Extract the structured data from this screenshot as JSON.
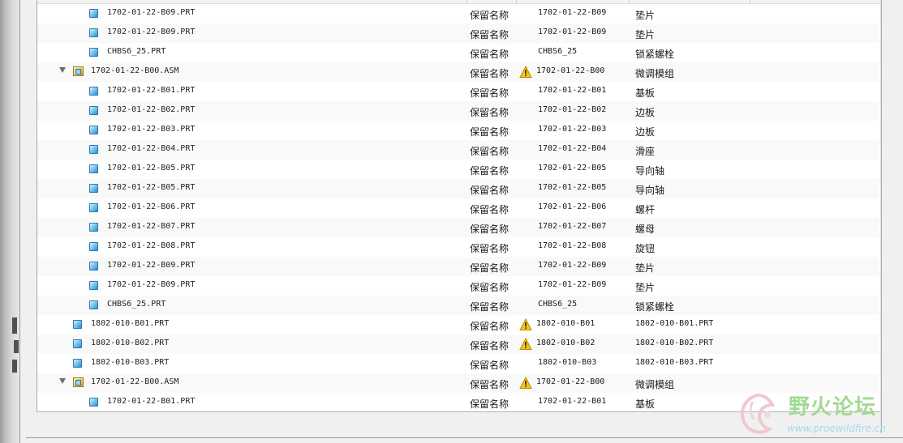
{
  "action_label": "保留名称",
  "rows": [
    {
      "depth": 2,
      "type": "prt",
      "name": "1702-01-22-B09.PRT",
      "action": "保留名称",
      "warning": false,
      "new_name": "1702-01-22-B09",
      "desc": "垫片"
    },
    {
      "depth": 2,
      "type": "prt",
      "name": "1702-01-22-B09.PRT",
      "action": "保留名称",
      "warning": false,
      "new_name": "1702-01-22-B09",
      "desc": "垫片"
    },
    {
      "depth": 2,
      "type": "prt",
      "name": "CHBS6_25.PRT",
      "action": "保留名称",
      "warning": false,
      "new_name": "CHBS6_25",
      "desc": "锁紧螺栓"
    },
    {
      "depth": 1,
      "type": "asm",
      "name": "1702-01-22-B00.ASM",
      "action": "保留名称",
      "warning": true,
      "new_name": "1702-01-22-B00",
      "desc": "微调模组"
    },
    {
      "depth": 2,
      "type": "prt",
      "name": "1702-01-22-B01.PRT",
      "action": "保留名称",
      "warning": false,
      "new_name": "1702-01-22-B01",
      "desc": "基板"
    },
    {
      "depth": 2,
      "type": "prt",
      "name": "1702-01-22-B02.PRT",
      "action": "保留名称",
      "warning": false,
      "new_name": "1702-01-22-B02",
      "desc": "边板"
    },
    {
      "depth": 2,
      "type": "prt",
      "name": "1702-01-22-B03.PRT",
      "action": "保留名称",
      "warning": false,
      "new_name": "1702-01-22-B03",
      "desc": "边板"
    },
    {
      "depth": 2,
      "type": "prt",
      "name": "1702-01-22-B04.PRT",
      "action": "保留名称",
      "warning": false,
      "new_name": "1702-01-22-B04",
      "desc": "滑座"
    },
    {
      "depth": 2,
      "type": "prt",
      "name": "1702-01-22-B05.PRT",
      "action": "保留名称",
      "warning": false,
      "new_name": "1702-01-22-B05",
      "desc": "导向轴"
    },
    {
      "depth": 2,
      "type": "prt",
      "name": "1702-01-22-B05.PRT",
      "action": "保留名称",
      "warning": false,
      "new_name": "1702-01-22-B05",
      "desc": "导向轴"
    },
    {
      "depth": 2,
      "type": "prt",
      "name": "1702-01-22-B06.PRT",
      "action": "保留名称",
      "warning": false,
      "new_name": "1702-01-22-B06",
      "desc": "螺杆"
    },
    {
      "depth": 2,
      "type": "prt",
      "name": "1702-01-22-B07.PRT",
      "action": "保留名称",
      "warning": false,
      "new_name": "1702-01-22-B07",
      "desc": "螺母"
    },
    {
      "depth": 2,
      "type": "prt",
      "name": "1702-01-22-B08.PRT",
      "action": "保留名称",
      "warning": false,
      "new_name": "1702-01-22-B08",
      "desc": "旋钮"
    },
    {
      "depth": 2,
      "type": "prt",
      "name": "1702-01-22-B09.PRT",
      "action": "保留名称",
      "warning": false,
      "new_name": "1702-01-22-B09",
      "desc": "垫片"
    },
    {
      "depth": 2,
      "type": "prt",
      "name": "1702-01-22-B09.PRT",
      "action": "保留名称",
      "warning": false,
      "new_name": "1702-01-22-B09",
      "desc": "垫片"
    },
    {
      "depth": 2,
      "type": "prt",
      "name": "CHBS6_25.PRT",
      "action": "保留名称",
      "warning": false,
      "new_name": "CHBS6_25",
      "desc": "锁紧螺栓"
    },
    {
      "depth": 1,
      "type": "prt",
      "name": "1802-010-B01.PRT",
      "action": "保留名称",
      "warning": true,
      "new_name": "1802-010-B01",
      "desc": "1802-010-B01.PRT"
    },
    {
      "depth": 1,
      "type": "prt",
      "name": "1802-010-B02.PRT",
      "action": "保留名称",
      "warning": true,
      "new_name": "1802-010-B02",
      "desc": "1802-010-B02.PRT"
    },
    {
      "depth": 1,
      "type": "prt",
      "name": "1802-010-B03.PRT",
      "action": "保留名称",
      "warning": false,
      "new_name": "1802-010-B03",
      "desc": "1802-010-B03.PRT"
    },
    {
      "depth": 1,
      "type": "asm",
      "name": "1702-01-22-B00.ASM",
      "action": "保留名称",
      "warning": true,
      "new_name": "1702-01-22-B00",
      "desc": "微调模组"
    },
    {
      "depth": 2,
      "type": "prt",
      "name": "1702-01-22-B01.PRT",
      "action": "保留名称",
      "warning": false,
      "new_name": "1702-01-22-B01",
      "desc": "基板"
    }
  ],
  "watermark": {
    "title": "野火论坛",
    "url": "www.proewildfire.cn"
  },
  "icons": {
    "part": "part-file-icon",
    "assembly": "assembly-file-icon",
    "warning": "warning-triangle-icon",
    "expand": "expand-triangle-icon"
  },
  "colors": {
    "warning_fill": "#f5c518",
    "part_icon": "#5fb6e8",
    "assembly_icon": "#e8b84a",
    "watermark_green": "#a2d993"
  }
}
